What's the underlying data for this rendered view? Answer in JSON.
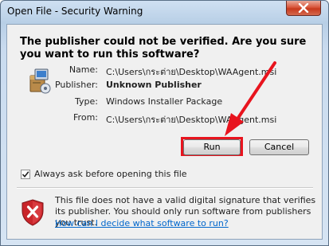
{
  "window": {
    "title": "Open File - Security Warning"
  },
  "headline": "The publisher could not be verified.  Are you sure you want to run this software?",
  "fields": [
    {
      "label": "Name:",
      "value": "C:\\Users\\กระต่าย\\Desktop\\WAAgent.msi",
      "bold": false
    },
    {
      "label": "Publisher:",
      "value": "Unknown Publisher",
      "bold": true
    },
    {
      "label": "Type:",
      "value": "Windows Installer Package",
      "bold": false
    },
    {
      "label": "From:",
      "value": "C:\\Users\\กระต่าย\\Desktop\\WAAgent.msi",
      "bold": false
    }
  ],
  "buttons": {
    "run": "Run",
    "cancel": "Cancel"
  },
  "checkbox": {
    "label": "Always ask before opening this file",
    "checked": true
  },
  "warning": {
    "text": "This file does not have a valid digital signature that verifies its publisher.  You should only run software from publishers you trust.",
    "link": "How can I decide what software to run?"
  },
  "colors": {
    "highlight": "#e8141e",
    "link": "#0066cc"
  },
  "icons": {
    "package": "installer-package-icon",
    "shield": "security-shield-icon",
    "close": "close-icon",
    "check": "checkmark-icon"
  }
}
